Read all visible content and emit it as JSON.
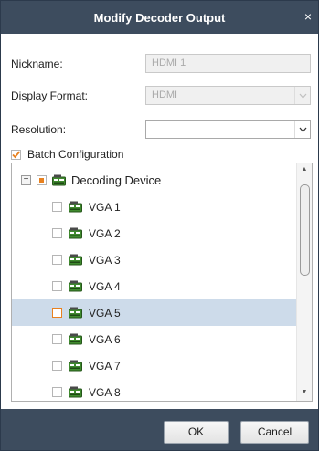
{
  "dialog": {
    "title": "Modify Decoder Output",
    "close_glyph": "×"
  },
  "form": {
    "nickname_label": "Nickname:",
    "nickname_value": "HDMI 1",
    "display_format_label": "Display Format:",
    "display_format_value": "HDMI",
    "resolution_label": "Resolution:",
    "resolution_value": ""
  },
  "batch": {
    "label": "Batch Configuration",
    "checked": true
  },
  "tree": {
    "root": {
      "label": "Decoding Device",
      "collapse_glyph": "−",
      "icon": "decoder-device-icon"
    },
    "items": [
      {
        "label": "VGA 1",
        "selected": false
      },
      {
        "label": "VGA 2",
        "selected": false
      },
      {
        "label": "VGA 3",
        "selected": false
      },
      {
        "label": "VGA 4",
        "selected": false
      },
      {
        "label": "VGA 5",
        "selected": true
      },
      {
        "label": "VGA 6",
        "selected": false
      },
      {
        "label": "VGA 7",
        "selected": false
      },
      {
        "label": "VGA 8",
        "selected": false
      }
    ]
  },
  "buttons": {
    "ok": "OK",
    "cancel": "Cancel"
  },
  "colors": {
    "titlebar": "#3d4c5e",
    "selection": "#cddbea",
    "check_orange": "#e8811f",
    "device_green": "#3f8a2e"
  }
}
